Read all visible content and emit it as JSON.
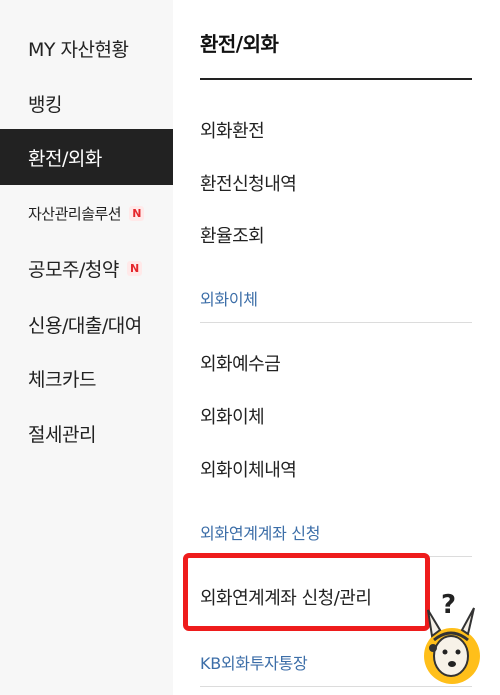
{
  "sidebar": {
    "items": [
      {
        "label": "MY 자산현황"
      },
      {
        "label": "뱅킹"
      },
      {
        "label": "환전/외화",
        "active": true
      },
      {
        "label": "자산관리솔루션",
        "badge": "N"
      },
      {
        "label": "공모주/청약",
        "badge": "N"
      },
      {
        "label": "신용/대출/대여"
      },
      {
        "label": "체크카드"
      },
      {
        "label": "절세관리"
      }
    ]
  },
  "content": {
    "title": "환전/외화",
    "group1": [
      "외화환전",
      "환전신청내역",
      "환율조회"
    ],
    "group2_label": "외화이체",
    "group2": [
      "외화예수금",
      "외화이체",
      "외화이체내역"
    ],
    "group3_label": "외화연계계좌 신청",
    "group3": [
      "외화연계계좌 신청/관리"
    ],
    "group4_label": "KB외화투자통장"
  },
  "helper": {
    "icon": "help-mascot-icon",
    "symbol": "?"
  },
  "colors": {
    "active_bg": "#222222",
    "link_blue": "#3c6ea8",
    "highlight_red": "#ee1c1c",
    "badge_red": "#e5262b"
  }
}
